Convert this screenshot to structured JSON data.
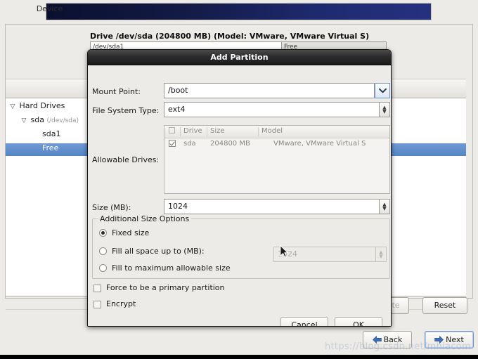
{
  "installer": {
    "drive_caption": "Drive /dev/sda (204800 MB) (Model: VMware, VMware Virtual S)",
    "partition_bar": [
      {
        "label": "/dev/sda1"
      },
      {
        "label": "Free"
      }
    ],
    "tree_columns": [
      {
        "label": "Device"
      },
      {
        "label": ""
      },
      {
        "label": ""
      }
    ],
    "tree_rows": [
      {
        "twisty": "▽",
        "label": "Hard Drives",
        "path": "",
        "selected": false,
        "indent": 8
      },
      {
        "twisty": "▽",
        "label": "sda",
        "path": "(/dev/sda)",
        "selected": false,
        "indent": 24
      },
      {
        "twisty": "",
        "label": "sda1",
        "path": "",
        "selected": false,
        "indent": 52
      },
      {
        "twisty": "",
        "label": "Free",
        "path": "",
        "selected": true,
        "indent": 52
      }
    ],
    "action_buttons": [
      {
        "label": "Delete",
        "disabled": true
      },
      {
        "label": "Reset",
        "disabled": false
      }
    ],
    "wizard_buttons": [
      {
        "label": "Back",
        "icon": "arrow-left-icon",
        "focused": false
      },
      {
        "label": "Next",
        "icon": "arrow-right-icon",
        "focused": true
      }
    ],
    "watermark": "https://blog.csdn.net/mhiacom"
  },
  "dialog": {
    "title": "Add Partition",
    "mount_point": {
      "label": "Mount Point:",
      "value": "/boot",
      "placeholder": "",
      "icon": "chevron-down-icon"
    },
    "file_system_type": {
      "label": "File System Type:",
      "value": "ext4",
      "icon": "chevron-updown-icon"
    },
    "allowable_drives": {
      "label": "Allowable Drives:",
      "columns": [
        "",
        "Drive",
        "Size",
        "Model"
      ],
      "rows": [
        {
          "checked": true,
          "drive": "sda",
          "size": "204800 MB",
          "model": "VMware, VMware Virtual S"
        }
      ]
    },
    "size": {
      "label": "Size (MB):",
      "value": "1024"
    },
    "additional_size_options": {
      "title": "Additional Size Options",
      "options": [
        {
          "label": "Fixed size",
          "selected": true
        },
        {
          "label": "Fill all space up to (MB):",
          "selected": false
        },
        {
          "label": "Fill to maximum allowable size",
          "selected": false
        }
      ],
      "fill_up_to_value": "1024"
    },
    "checkboxes": [
      {
        "label": "Force to be a primary partition",
        "checked": false
      },
      {
        "label": "Encrypt",
        "checked": false
      }
    ],
    "buttons": [
      {
        "label": "Cancel"
      },
      {
        "label": "OK"
      }
    ]
  },
  "colors": {
    "selection_blue": "#5585c4",
    "banner_navy": "#1d2a6e",
    "window_bg": "#edebe7",
    "titlebar_dark": "#2c2c2c"
  }
}
